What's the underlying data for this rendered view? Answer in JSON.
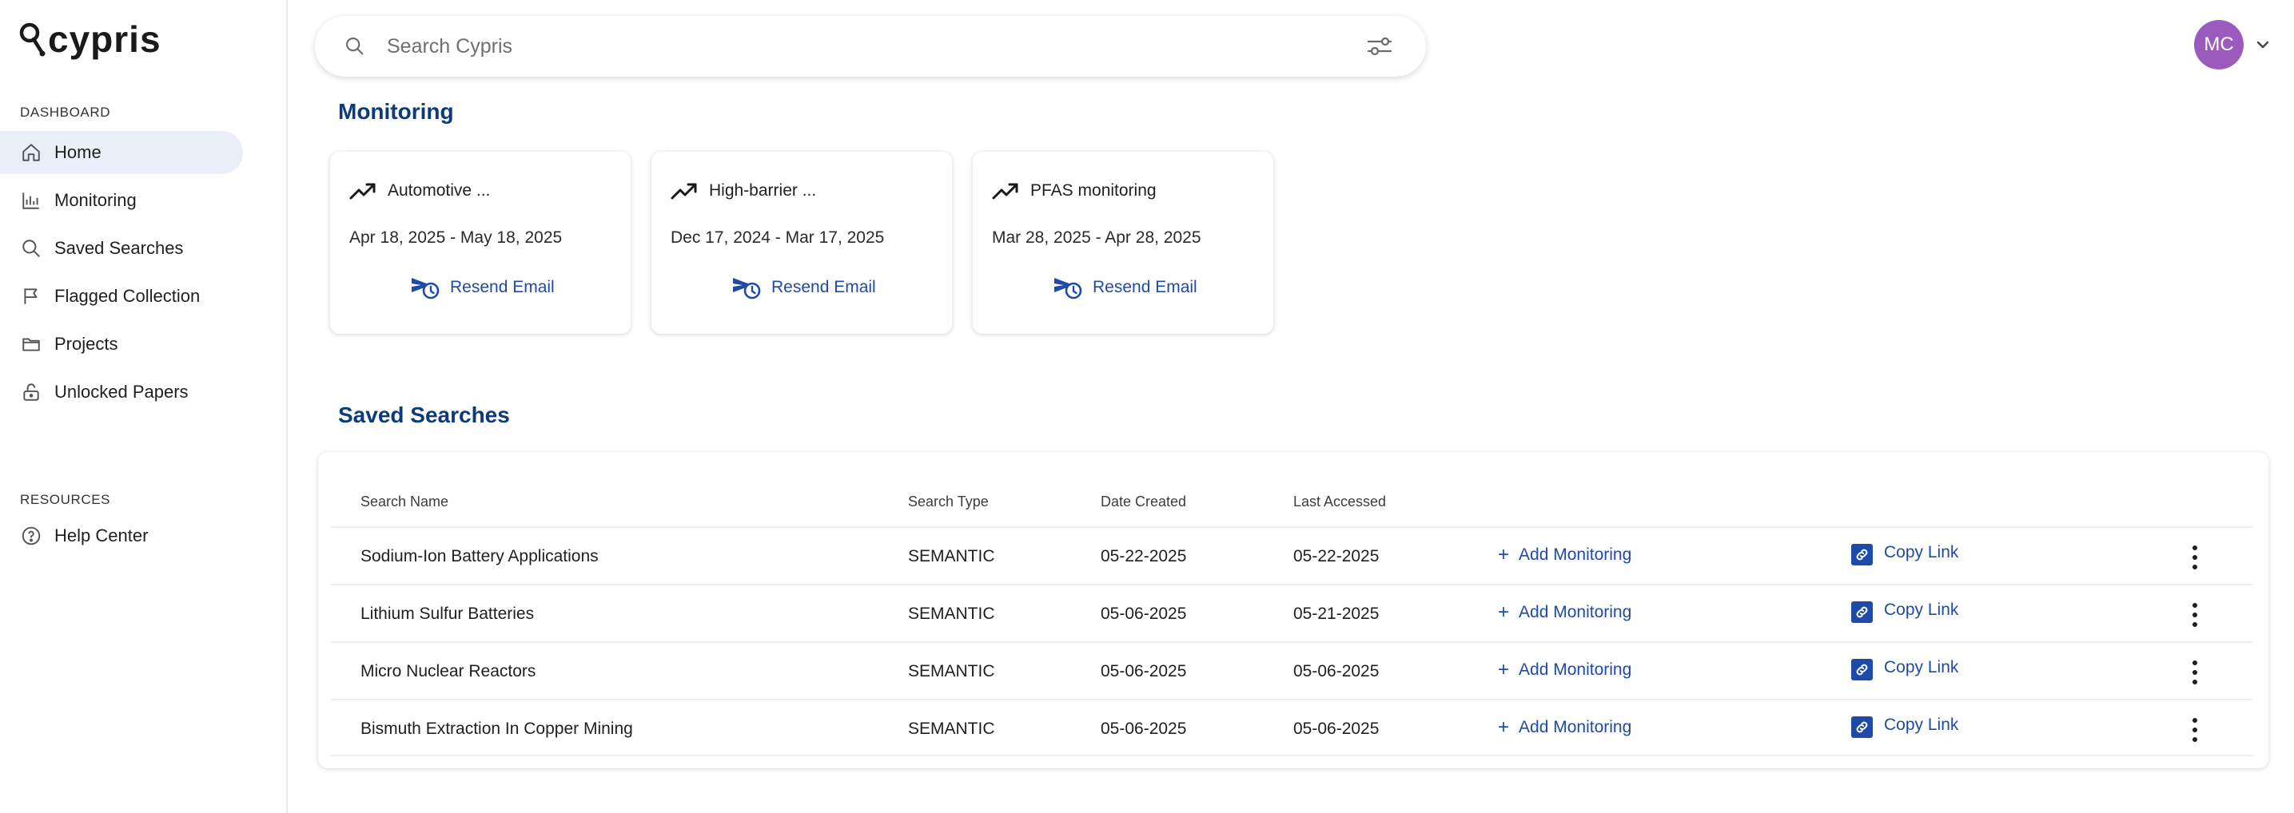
{
  "brand": {
    "name": "cypris"
  },
  "sidebar": {
    "dashboard_label": "DASHBOARD",
    "items": [
      {
        "label": "Home",
        "icon": "home-icon",
        "active": true
      },
      {
        "label": "Monitoring",
        "icon": "bar-chart-icon"
      },
      {
        "label": "Saved Searches",
        "icon": "search-icon"
      },
      {
        "label": "Flagged Collection",
        "icon": "flag-icon"
      },
      {
        "label": "Projects",
        "icon": "folder-icon"
      },
      {
        "label": "Unlocked Papers",
        "icon": "unlock-icon"
      }
    ],
    "resources_label": "RESOURCES",
    "resources": [
      {
        "label": "Help Center",
        "icon": "help-circle-icon"
      }
    ]
  },
  "search": {
    "placeholder": "Search Cypris"
  },
  "user": {
    "initials": "MC",
    "avatar_color": "#9b5bbd"
  },
  "monitoring": {
    "heading": "Monitoring",
    "cards": [
      {
        "title": "Automotive ...",
        "date_range": "Apr 18, 2025 - May 18, 2025",
        "action": "Resend Email"
      },
      {
        "title": "High-barrier ...",
        "date_range": "Dec 17, 2024 - Mar 17, 2025",
        "action": "Resend Email"
      },
      {
        "title": "PFAS monitoring",
        "date_range": "Mar 28, 2025 - Apr 28, 2025",
        "action": "Resend Email"
      }
    ]
  },
  "saved_searches": {
    "heading": "Saved Searches",
    "columns": [
      "Search Name",
      "Search Type",
      "Date Created",
      "Last Accessed"
    ],
    "rows": [
      {
        "name": "Sodium-Ion Battery Applications",
        "type": "SEMANTIC",
        "created": "05-22-2025",
        "accessed": "05-22-2025",
        "add_label": "Add Monitoring",
        "copy_label": "Copy Link"
      },
      {
        "name": "Lithium Sulfur Batteries",
        "type": "SEMANTIC",
        "created": "05-06-2025",
        "accessed": "05-21-2025",
        "add_label": "Add Monitoring",
        "copy_label": "Copy Link"
      },
      {
        "name": "Micro Nuclear Reactors",
        "type": "SEMANTIC",
        "created": "05-06-2025",
        "accessed": "05-06-2025",
        "add_label": "Add Monitoring",
        "copy_label": "Copy Link"
      },
      {
        "name": "Bismuth Extraction In Copper Mining",
        "type": "SEMANTIC",
        "created": "05-06-2025",
        "accessed": "05-06-2025",
        "add_label": "Add Monitoring",
        "copy_label": "Copy Link"
      }
    ]
  },
  "colors": {
    "accent": "#1e4aa8",
    "heading": "#0d3a7a",
    "active_nav_bg": "#eaeef8"
  }
}
